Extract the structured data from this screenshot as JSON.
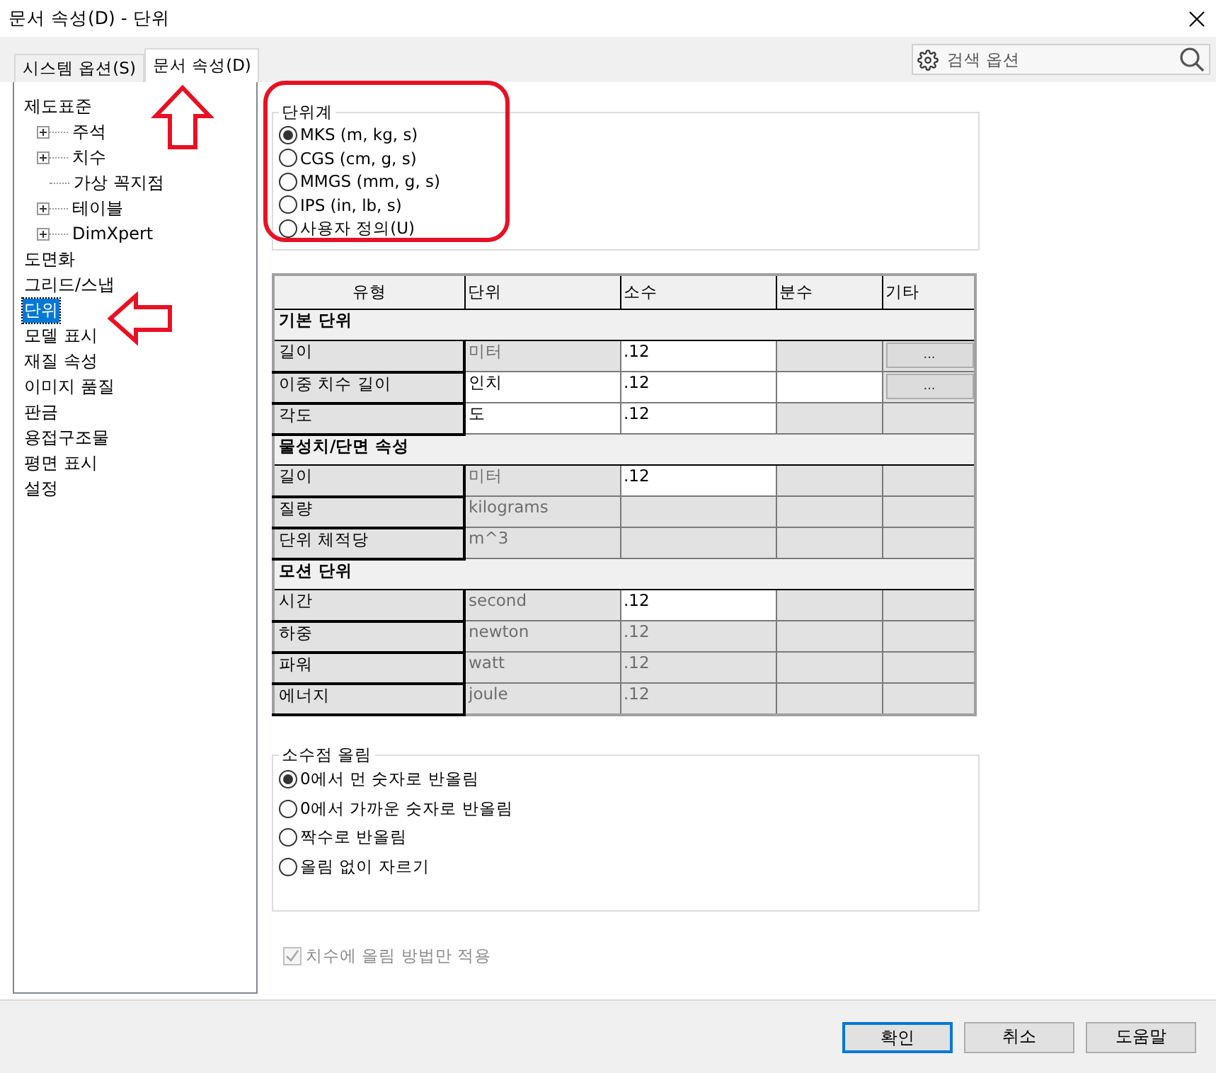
{
  "window": {
    "title": "문서 속성(D) - 단위"
  },
  "tabs": [
    {
      "label": "시스템 옵션(S)",
      "selected": false
    },
    {
      "label": "문서 속성(D)",
      "selected": true
    }
  ],
  "search": {
    "placeholder": "검색 옵션"
  },
  "tree": [
    {
      "label": "제도표준",
      "selected": false,
      "children": [
        {
          "label": "주석",
          "selected": false,
          "expanded": false
        },
        {
          "label": "치수",
          "selected": false,
          "expanded": false
        },
        {
          "label": "가상 꼭지점",
          "selected": false
        },
        {
          "label": "테이블",
          "selected": false,
          "expanded": false
        },
        {
          "label": "DimXpert",
          "selected": false,
          "expanded": false
        }
      ]
    },
    {
      "label": "도면화",
      "selected": false
    },
    {
      "label": "그리드/스냅",
      "selected": false
    },
    {
      "label": "단위",
      "selected": true
    },
    {
      "label": "모델 표시",
      "selected": false
    },
    {
      "label": "재질 속성",
      "selected": false
    },
    {
      "label": "이미지 품질",
      "selected": false
    },
    {
      "label": "판금",
      "selected": false
    },
    {
      "label": "용접구조물",
      "selected": false
    },
    {
      "label": "평면 표시",
      "selected": false
    },
    {
      "label": "설정",
      "selected": false
    }
  ],
  "unit_system": {
    "title": "단위계",
    "options": [
      {
        "label": "MKS (m, kg, s)",
        "selected": true
      },
      {
        "label": "CGS  (cm, g, s)",
        "selected": false
      },
      {
        "label": "MMGS  (mm, g, s)",
        "selected": false
      },
      {
        "label": "IPS  (in, lb, s)",
        "selected": false
      },
      {
        "label": "사용자 정의(U)",
        "selected": false
      }
    ]
  },
  "table": {
    "columns": [
      "유형",
      "단위",
      "소수",
      "분수",
      "기타"
    ],
    "sections": [
      {
        "title": "기본 단위",
        "rows": [
          {
            "type": "길이",
            "unit": {
              "text": "미터",
              "editable": false
            },
            "decimal": {
              "text": ".12",
              "editable": true
            },
            "fraction": {
              "editable": false
            },
            "other": {
              "text": "..."
            }
          },
          {
            "type": "이중 치수 길이",
            "unit": {
              "text": "인치",
              "editable": true
            },
            "decimal": {
              "text": ".12",
              "editable": true
            },
            "fraction": {
              "editable": true
            },
            "other": {
              "text": "..."
            }
          },
          {
            "type": "각도",
            "unit": {
              "text": "도",
              "editable": true
            },
            "decimal": {
              "text": ".12",
              "editable": true
            },
            "fraction": {
              "editable": false
            }
          }
        ]
      },
      {
        "title": "물성치/단면 속성",
        "rows": [
          {
            "type": "길이",
            "unit": {
              "text": "미터",
              "editable": false
            },
            "decimal": {
              "text": ".12",
              "editable": true
            },
            "fraction": {
              "editable": false
            }
          },
          {
            "type": "질량",
            "unit": {
              "text": "kilograms",
              "editable": false
            },
            "decimal": {
              "editable": false
            },
            "fraction": {
              "editable": false
            }
          },
          {
            "type": "단위 체적당",
            "unit": {
              "text": "m^3",
              "editable": false
            },
            "decimal": {
              "editable": false
            },
            "fraction": {
              "editable": false
            }
          }
        ]
      },
      {
        "title": "모션 단위",
        "rows": [
          {
            "type": "시간",
            "unit": {
              "text": "second",
              "editable": false
            },
            "decimal": {
              "text": ".12",
              "editable": true
            },
            "fraction": {
              "editable": false
            }
          },
          {
            "type": "하중",
            "unit": {
              "text": "newton",
              "editable": false
            },
            "decimal": {
              "text": ".12",
              "editable": false
            },
            "fraction": {
              "editable": false
            }
          },
          {
            "type": "파워",
            "unit": {
              "text": "watt",
              "editable": false
            },
            "decimal": {
              "text": ".12",
              "editable": false
            },
            "fraction": {
              "editable": false
            }
          },
          {
            "type": "에너지",
            "unit": {
              "text": "joule",
              "editable": false
            },
            "decimal": {
              "text": ".12",
              "editable": false
            },
            "fraction": {
              "editable": false
            }
          }
        ]
      }
    ]
  },
  "rounding": {
    "title": "소수점 올림",
    "options": [
      {
        "label": "0에서 먼 숫자로 반올림",
        "selected": true
      },
      {
        "label": "0에서 가까운 숫자로 반올림",
        "selected": false
      },
      {
        "label": "짝수로 반올림",
        "selected": false
      },
      {
        "label": "올림 없이 자르기",
        "selected": false
      }
    ]
  },
  "apply_checkbox": {
    "label": "치수에 올림 방법만 적용",
    "checked": true,
    "disabled": true
  },
  "buttons": [
    {
      "label": "확인",
      "default": true
    },
    {
      "label": "취소",
      "default": false
    },
    {
      "label": "도움말",
      "default": false
    }
  ]
}
